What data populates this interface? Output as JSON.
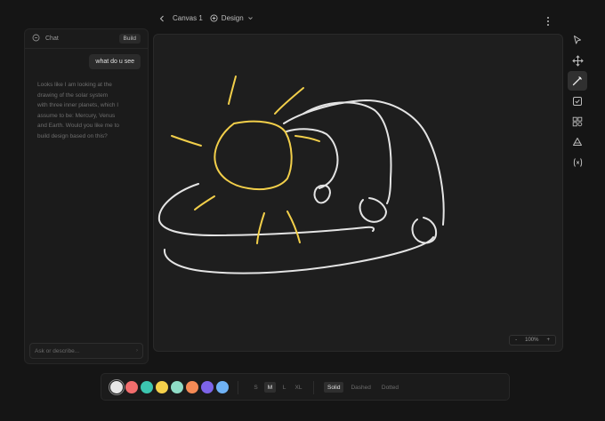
{
  "header": {
    "canvas_name": "Canvas 1",
    "mode_label": "Design"
  },
  "chat": {
    "title": "Chat",
    "build_label": "Build",
    "user_message": "what do u see",
    "assistant_reply_lines": [
      "Looks like I am looking at the",
      "drawing of the solar system",
      "with three inner planets, which I",
      "assume to be: Mercury, Venus",
      "and Earth. Would you like me to",
      "build design based on this?"
    ],
    "input_placeholder": "Ask or describe..."
  },
  "canvas": {
    "zoom_minus": "-",
    "zoom_level": "100%",
    "zoom_plus": "+",
    "stroke_colors": {
      "white": "#e4e4e4",
      "yellow": "#f2cf4a"
    }
  },
  "toolbar_right": {
    "tools": [
      "select-icon",
      "move-icon",
      "pen-icon",
      "checkbox-icon",
      "components-icon",
      "fill-icon",
      "variable-icon"
    ],
    "active_tool": "pen-icon"
  },
  "bottom_toolbar": {
    "colors": [
      "#e6e6e6",
      "#f26d6d",
      "#3cc6b0",
      "#f5d04a",
      "#8fdcc6",
      "#f58a55",
      "#7d64e8",
      "#6fb2f5"
    ],
    "selected_color": "#e6e6e6",
    "sizes": [
      "S",
      "M",
      "L",
      "XL"
    ],
    "selected_size": "M",
    "styles": [
      "Solid",
      "Dashed",
      "Dotted"
    ],
    "selected_style": "Solid"
  }
}
